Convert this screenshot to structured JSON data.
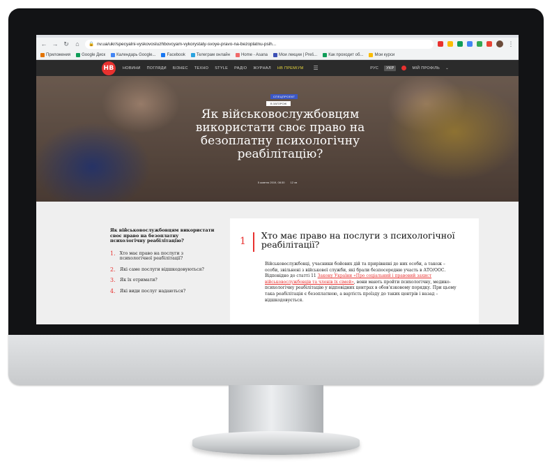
{
  "browser": {
    "url": "nv.ua/ukr/specyalni-vyskovosluzhbovcyam-vykorystaty-svoye-pravo-na-bezoplatnu-psih...",
    "bookmarks": [
      {
        "label": "Приложения",
        "color": "#e37400"
      },
      {
        "label": "Google Диск",
        "color": "#0f9d58"
      },
      {
        "label": "Календарь Google...",
        "color": "#4285f4"
      },
      {
        "label": "Facebook",
        "color": "#1877f2"
      },
      {
        "label": "Телеграм онлайн",
        "color": "#2aa3df"
      },
      {
        "label": "Home - Asana",
        "color": "#f06a6a"
      },
      {
        "label": "Мои лекции | Preš...",
        "color": "#3c4fb5"
      },
      {
        "label": "Как проходит об...",
        "color": "#0f9d58"
      },
      {
        "label": "Мои курси",
        "color": "#fbbc04"
      }
    ]
  },
  "site": {
    "logo": "НВ",
    "menu": [
      "НОВИНИ",
      "ПОГЛЯДИ",
      "БІЗНЕС",
      "ТЕХНО",
      "STYLE",
      "РАДІО",
      "ЖУРНАЛ"
    ],
    "promo": "НВ ПРЕМІУМ",
    "lang_ru": "РУС",
    "lang_ua": "УКР",
    "profile": "МІЙ ПРОФІЛЬ"
  },
  "hero": {
    "badge_top": "СПЕЦПРОЕКТ",
    "badge_sub": "В ЗАГОРОЖ",
    "title": "Як військовослужбовцям використати своє право на безоплатну психологічну реабілітацію?",
    "date": "5 жовтня 2019, 08:30",
    "views": "12 хв"
  },
  "toc": {
    "title": "Як військовослужбовцям використати своє право на безоплатну психологічну реабілітацію?",
    "items": [
      {
        "n": "1.",
        "text": "Хто має право на послуги з психологічної реабілітації?"
      },
      {
        "n": "2.",
        "text": "Які саме послуги відшкодовуються?"
      },
      {
        "n": "3.",
        "text": "Як їх отримати?"
      },
      {
        "n": "4.",
        "text": "Які види послуг надаються?"
      }
    ]
  },
  "article": {
    "section_number": "1",
    "section_title": "Хто має право на послуги з психологічної реабілітації?",
    "text_1": "Військовослужбовці, учасники бойових дій та прирівняні до них особи, а також – особи, звільнені з військової служби, які брали безпосередню участь в АТО/ООС. Відповідно до статті 11 ",
    "link_text": "Закону України «Про соціальний і правовий захист військовослужбовців та членів їх сімей»",
    "text_2": ", вони мають пройти психологічну, медико-психологічну реабілітацію у відповідних центрах в обов'язковому порядку. При цьому така реабілітація є безоплатною, а вартість проїзду до таких центрів і назад – відшкодовується."
  }
}
